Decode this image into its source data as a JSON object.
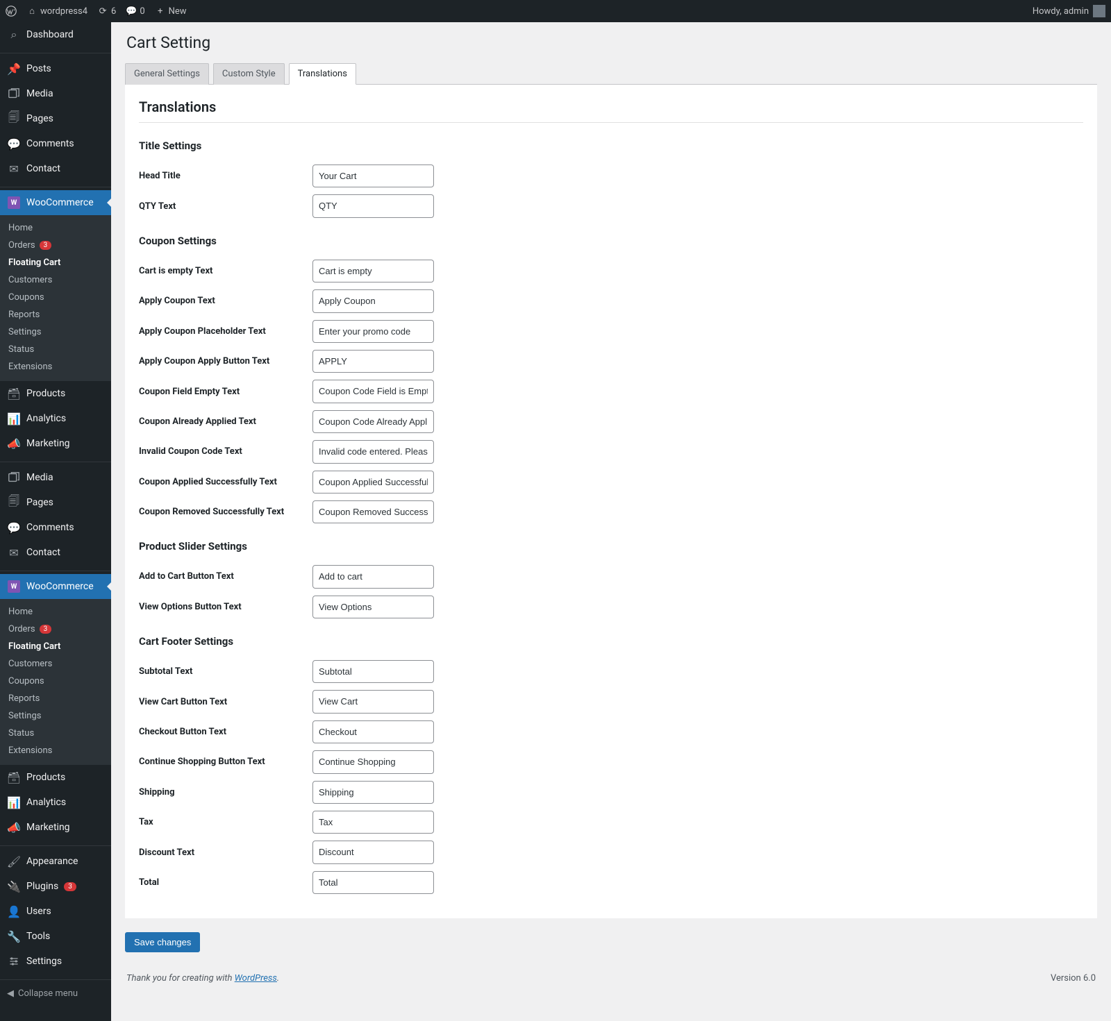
{
  "adminbar": {
    "site_name": "wordpress4",
    "updates_count": "6",
    "comments_count": "0",
    "new_label": "New",
    "howdy": "Howdy, admin"
  },
  "sidebar": {
    "dashboard": "Dashboard",
    "posts": "Posts",
    "media": "Media",
    "pages": "Pages",
    "comments": "Comments",
    "contact": "Contact",
    "woocommerce": "WooCommerce",
    "woo_sub": {
      "home": "Home",
      "orders": "Orders",
      "orders_badge": "3",
      "floating_cart": "Floating Cart",
      "customers": "Customers",
      "coupons": "Coupons",
      "reports": "Reports",
      "settings": "Settings",
      "status": "Status",
      "extensions": "Extensions"
    },
    "products": "Products",
    "analytics": "Analytics",
    "marketing": "Marketing",
    "media2": "Media",
    "pages2": "Pages",
    "comments2": "Comments",
    "contact2": "Contact",
    "woocommerce2": "WooCommerce",
    "products2": "Products",
    "analytics2": "Analytics",
    "marketing2": "Marketing",
    "appearance": "Appearance",
    "plugins": "Plugins",
    "plugins_badge": "3",
    "users": "Users",
    "tools": "Tools",
    "settings": "Settings",
    "collapse": "Collapse menu"
  },
  "page": {
    "title": "Cart Setting",
    "tabs": {
      "general": "General Settings",
      "custom": "Custom Style",
      "translations": "Translations"
    },
    "section_title": "Translations",
    "groups": {
      "title_settings": {
        "heading": "Title Settings",
        "head_title_label": "Head Title",
        "head_title_value": "Your Cart",
        "qty_label": "QTY Text",
        "qty_value": "QTY"
      },
      "coupon_settings": {
        "heading": "Coupon Settings",
        "cart_empty_label": "Cart is empty Text",
        "cart_empty_value": "Cart is empty",
        "apply_coupon_label": "Apply Coupon Text",
        "apply_coupon_value": "Apply Coupon",
        "apply_ph_label": "Apply Coupon Placeholder Text",
        "apply_ph_value": "Enter your promo code",
        "apply_btn_label": "Apply Coupon Apply Button Text",
        "apply_btn_value": "APPLY",
        "field_empty_label": "Coupon Field Empty Text",
        "field_empty_value": "Coupon Code Field is Empty",
        "already_label": "Coupon Already Applied Text",
        "already_value": "Coupon Code Already Applied",
        "invalid_label": "Invalid Coupon Code Text",
        "invalid_value": "Invalid code entered. Please try again",
        "applied_ok_label": "Coupon Applied Successfully Text",
        "applied_ok_value": "Coupon Applied Successfully",
        "removed_ok_label": "Coupon Removed Successfully Text",
        "removed_ok_value": "Coupon Removed Successfully"
      },
      "product_slider": {
        "heading": "Product Slider Settings",
        "add_label": "Add to Cart Button Text",
        "add_value": "Add to cart",
        "view_label": "View Options Button Text",
        "view_value": "View Options"
      },
      "cart_footer": {
        "heading": "Cart Footer Settings",
        "subtotal_label": "Subtotal Text",
        "subtotal_value": "Subtotal",
        "view_cart_label": "View Cart Button Text",
        "view_cart_value": "View Cart",
        "checkout_label": "Checkout Button Text",
        "checkout_value": "Checkout",
        "continue_label": "Continue Shopping Button Text",
        "continue_value": "Continue Shopping",
        "shipping_label": "Shipping",
        "shipping_value": "Shipping",
        "tax_label": "Tax",
        "tax_value": "Tax",
        "discount_label": "Discount Text",
        "discount_value": "Discount",
        "total_label": "Total",
        "total_value": "Total"
      }
    },
    "save_button": "Save changes"
  },
  "footer": {
    "thank_you": "Thank you for creating with ",
    "wp_link": "WordPress",
    "period": ".",
    "version": "Version 6.0"
  }
}
